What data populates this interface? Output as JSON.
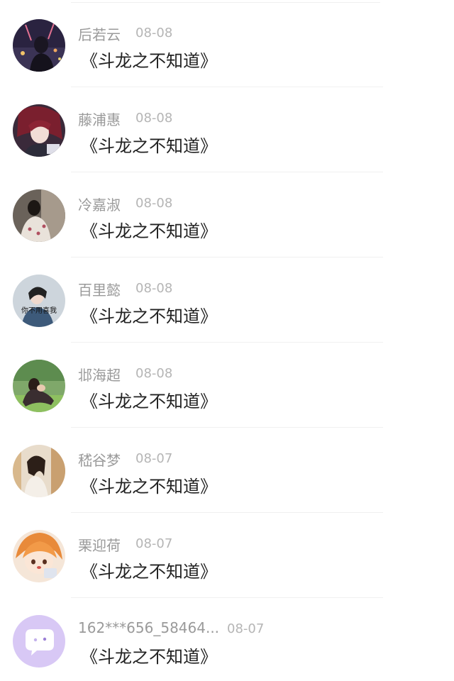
{
  "comments": [
    {
      "user": "后若云",
      "date": "08-08",
      "text": "《斗龙之不知道》",
      "avatar_icon": "user-avatar-photo"
    },
    {
      "user": "藤浦惠",
      "date": "08-08",
      "text": "《斗龙之不知道》",
      "avatar_icon": "user-avatar-photo"
    },
    {
      "user": "冷嘉淑",
      "date": "08-08",
      "text": "《斗龙之不知道》",
      "avatar_icon": "user-avatar-photo"
    },
    {
      "user": "百里懿",
      "date": "08-08",
      "text": "《斗龙之不知道》",
      "avatar_icon": "user-avatar-photo",
      "avatar_caption": "你不用喜我"
    },
    {
      "user": "邶海超",
      "date": "08-08",
      "text": "《斗龙之不知道》",
      "avatar_icon": "user-avatar-photo"
    },
    {
      "user": "嵇谷梦",
      "date": "08-07",
      "text": "《斗龙之不知道》",
      "avatar_icon": "user-avatar-photo"
    },
    {
      "user": "栗迎荷",
      "date": "08-07",
      "text": "《斗龙之不知道》",
      "avatar_icon": "user-avatar-photo"
    },
    {
      "user": "162***656_58464...",
      "date": "08-07",
      "text": "《斗龙之不知道》",
      "avatar_icon": "default-chat-bubble-avatar"
    }
  ],
  "colors": {
    "name": "#9a9a9a",
    "date": "#b5b5b5",
    "comment": "#222222",
    "divider": "#f0f0f0",
    "default_avatar": "#d8c8f5"
  }
}
